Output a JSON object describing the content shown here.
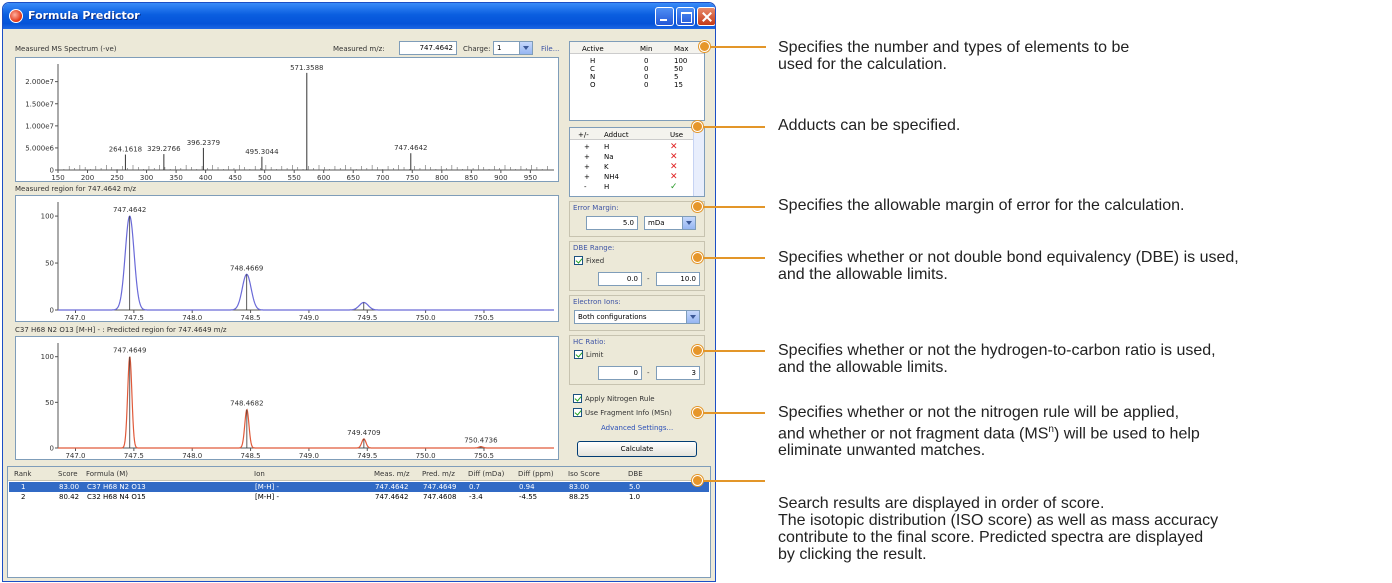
{
  "window": {
    "title": "Formula Predictor"
  },
  "spectrum": {
    "label": "Measured MS Spectrum (-ve)",
    "measured_mz_label": "Measured m/z:",
    "measured_mz_value": "747.4642",
    "charge_label": "Charge:",
    "charge_value": "1",
    "file_button": "File..."
  },
  "region_measured": {
    "label": "Measured region for 747.4642 m/z"
  },
  "region_predicted": {
    "label": "C37 H68 N2 O13 [M-H] - : Predicted region for 747.4649 m/z"
  },
  "elements": {
    "headers": [
      "Active",
      "Min",
      "Max"
    ],
    "rows": [
      {
        "name": "H",
        "min": "0",
        "max": "100"
      },
      {
        "name": "C",
        "min": "0",
        "max": "50"
      },
      {
        "name": "N",
        "min": "0",
        "max": "5"
      },
      {
        "name": "O",
        "min": "0",
        "max": "15"
      }
    ]
  },
  "adducts": {
    "headers": [
      "+/-",
      "Adduct",
      "Use"
    ],
    "rows": [
      {
        "sign": "+",
        "name": "H",
        "use": "✕"
      },
      {
        "sign": "+",
        "name": "Na",
        "use": "✕"
      },
      {
        "sign": "+",
        "name": "K",
        "use": "✕"
      },
      {
        "sign": "+",
        "name": "NH4",
        "use": "✕"
      },
      {
        "sign": "-",
        "name": "H",
        "use": "✓"
      }
    ]
  },
  "error_margin": {
    "label": "Error Margin:",
    "value": "5.0",
    "unit": "mDa"
  },
  "dbe_range": {
    "label": "DBE Range:",
    "fixed_label": "Fixed",
    "min": "0.0",
    "dash": "-",
    "max": "10.0"
  },
  "electron_ions": {
    "label": "Electron Ions:",
    "value": "Both configurations"
  },
  "hc_ratio": {
    "label": "HC Ratio:",
    "limit_label": "Limit",
    "min": "0",
    "dash": "-",
    "max": "3"
  },
  "options": {
    "nitrogen_rule": "Apply Nitrogen Rule",
    "fragment_info": "Use Fragment Info (MSn)",
    "advanced_link": "Advanced Settings...",
    "calculate_button": "Calculate"
  },
  "results": {
    "headers": [
      "Rank",
      "Score",
      "Formula (M)",
      "Ion",
      "Meas. m/z",
      "Pred. m/z",
      "Diff (mDa)",
      "Diff (ppm)",
      "Iso Score",
      "DBE"
    ],
    "rows": [
      [
        "1",
        "83.00",
        "C37 H68 N2 O13",
        "[M-H] -",
        "747.4642",
        "747.4649",
        "0.7",
        "0.94",
        "83.00",
        "5.0"
      ],
      [
        "2",
        "80.42",
        "C32 H68 N4 O15",
        "[M-H] -",
        "747.4642",
        "747.4608",
        "-3.4",
        "-4.55",
        "88.25",
        "1.0"
      ]
    ]
  },
  "annotations": {
    "a1_l1": "Specifies the number and types of elements to be",
    "a1_l2": "used for the calculation.",
    "a2": "Adducts can be specified.",
    "a3": "Specifies the allowable margin of error for the calculation.",
    "a4_l1": "Specifies whether or not double bond equivalency (DBE) is used,",
    "a4_l2": "and the allowable limits.",
    "a5_l1": "Specifies whether or not the hydrogen-to-carbon ratio is used,",
    "a5_l2": "and the allowable limits.",
    "a6_l1": "Specifies whether or not the nitrogen rule will be applied,",
    "a6_l2a": "and whether or not fragment data (MS",
    "a6_sup": "n",
    "a6_l2b": ") will be used to help",
    "a6_l3": "eliminate unwanted matches.",
    "a7_l1": "Search results are displayed in order of score.",
    "a7_l2": "The isotopic distribution (ISO score) as well as mass accuracy",
    "a7_l3": "contribute to the final score.  Predicted spectra are displayed",
    "a7_l4": "by clicking the result."
  },
  "chart_data": [
    {
      "type": "bar",
      "title": "Measured MS Spectrum (-ve)",
      "x": [
        264.1618,
        329.2766,
        396.2379,
        495.3044,
        571.3588,
        747.4642
      ],
      "y": [
        3500000,
        3600000,
        5000000,
        3000000,
        22000000,
        3800000
      ],
      "peak_labels": [
        "264.1618",
        "329.2766",
        "396.2379",
        "495.3044",
        "571.3588",
        "747.4642"
      ],
      "xticks": [
        "150",
        "200",
        "250",
        "300",
        "350",
        "400",
        "450",
        "500",
        "550",
        "600",
        "650",
        "700",
        "750",
        "800",
        "850",
        "900",
        "950"
      ],
      "yticks": [
        "0",
        "5.000e6",
        "1.000e7",
        "1.500e7",
        "2.000e7"
      ],
      "xlim": [
        150,
        990
      ],
      "ylim": [
        0,
        24000000
      ]
    },
    {
      "type": "line",
      "title": "Measured region for 747.4642 m/z",
      "peaks": [
        {
          "x": 747.4642,
          "y": 100,
          "label": "747.4642"
        },
        {
          "x": 748.4669,
          "y": 38,
          "label": "748.4669"
        },
        {
          "x": 749.47,
          "y": 8,
          "label": ""
        }
      ],
      "xticks": [
        "747.0",
        "747.5",
        "748.0",
        "748.5",
        "749.0",
        "749.5",
        "750.0",
        "750.5"
      ],
      "yticks": [
        "0",
        "50",
        "100"
      ],
      "xlim": [
        746.85,
        751.1
      ],
      "ylim": [
        0,
        115
      ],
      "color": "#6a6ad8"
    },
    {
      "type": "line",
      "title": "C37 H68 N2 O13 [M-H] - : Predicted region for 747.4649 m/z",
      "peaks": [
        {
          "x": 747.4649,
          "y": 100,
          "label": "747.4649"
        },
        {
          "x": 748.4682,
          "y": 42,
          "label": "748.4682"
        },
        {
          "x": 749.4709,
          "y": 10,
          "label": "749.4709"
        },
        {
          "x": 750.4736,
          "y": 1.5,
          "label": "750.4736"
        }
      ],
      "xticks": [
        "747.0",
        "747.5",
        "748.0",
        "748.5",
        "749.0",
        "749.5",
        "750.0",
        "750.5"
      ],
      "yticks": [
        "0",
        "50",
        "100"
      ],
      "xlim": [
        746.85,
        751.1
      ],
      "ylim": [
        0,
        115
      ],
      "color": "#e05a3a"
    }
  ]
}
